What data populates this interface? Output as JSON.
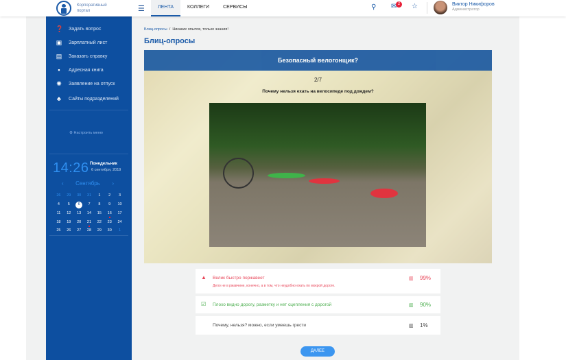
{
  "header": {
    "logo_text": "Корпоративный портал",
    "nav": [
      "ЛЕНТА",
      "КОЛЛЕГИ",
      "СЕРВИСЫ"
    ],
    "mail_badge": "2",
    "user_name": "Виктор Никифоров",
    "user_role": "Администратор"
  },
  "sidebar": {
    "items": [
      {
        "label": "Задать вопрос",
        "icon": "question-icon"
      },
      {
        "label": "Зарплатный лист",
        "icon": "money-icon"
      },
      {
        "label": "Заказать справку",
        "icon": "document-icon"
      },
      {
        "label": "Адресная книга",
        "icon": "contact-icon"
      },
      {
        "label": "Заявление на отпуск",
        "icon": "sun-icon"
      },
      {
        "label": "Сайты подразделений",
        "icon": "hierarchy-icon"
      }
    ],
    "settings": "Настроить меню",
    "clock": {
      "time": "14:26",
      "day": "Понедельник",
      "date": "6 сентября, 2019",
      "month": "Сентябрь"
    },
    "calendar": [
      "26",
      "29",
      "30",
      "31",
      "1",
      "2",
      "3",
      "4",
      "5",
      "6",
      "7",
      "8",
      "9",
      "10",
      "11",
      "12",
      "13",
      "14",
      "15",
      "16",
      "17",
      "18",
      "19",
      "20",
      "21",
      "22",
      "23",
      "24",
      "25",
      "26",
      "27",
      "28",
      "29",
      "30",
      "1"
    ]
  },
  "main": {
    "breadcrumb": [
      "Блиц-опросы",
      "Никаких опытов, только знания!"
    ],
    "title": "Блиц-опросы",
    "quiz_title": "Безопасный велогонщик?",
    "progress": "2/7",
    "question": "Почему нельзя ехать на велосипеде под дождем?",
    "answers": [
      {
        "label": "Велик быстро поржавеет",
        "note": "Дело не в ржавчине, конечно, а в том, что неудобно ехать по мокрой дороге.",
        "percent": "99%",
        "state": "wrong",
        "color": "#e8475a"
      },
      {
        "label": "Плохо видно дорогу, разметку и нет сцепления с дорогой",
        "percent": "90%",
        "state": "correct",
        "color": "#4cae4f"
      },
      {
        "label": "Почему, нельзя? можно, если умеешь грести",
        "percent": "1%",
        "state": "neutral",
        "color": "#444444"
      }
    ],
    "next_label": "ДАЛЕЕ"
  }
}
